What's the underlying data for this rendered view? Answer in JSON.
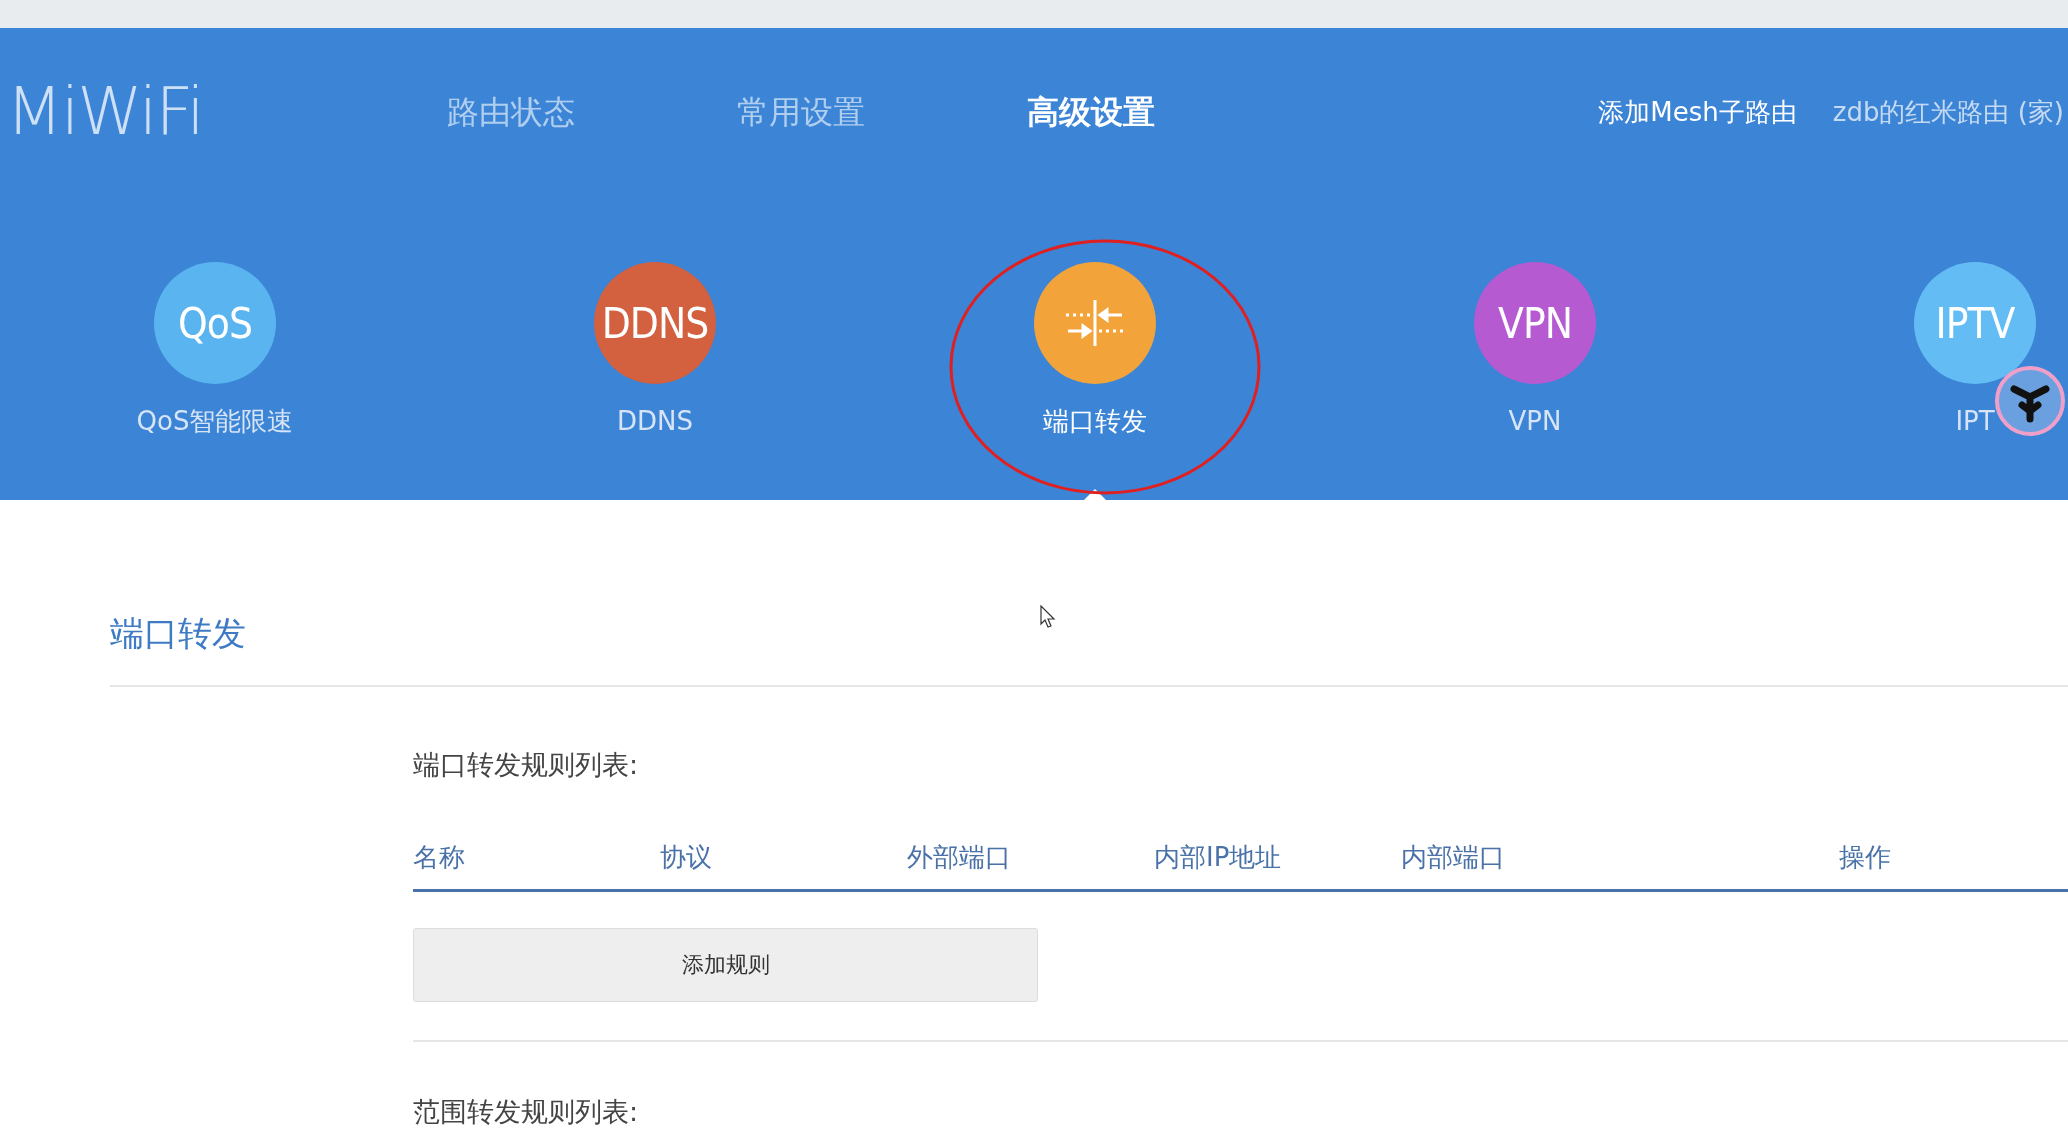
{
  "header": {
    "logo": "MiWiFi",
    "nav": [
      {
        "label": "路由状态",
        "selected": false
      },
      {
        "label": "常用设置",
        "selected": false
      },
      {
        "label": "高级设置",
        "selected": true
      }
    ],
    "links": [
      "添加Mesh子路由",
      "zdb的红米路由 (家)"
    ]
  },
  "features": [
    {
      "badge_text": "QoS",
      "label": "QoS智能限速",
      "color": "#5ab4ef",
      "selected": false
    },
    {
      "badge_text": "DDNS",
      "label": "DDNS",
      "color": "#d3603e",
      "selected": false
    },
    {
      "label": "端口转发",
      "color": "#f2a33a",
      "selected": true
    },
    {
      "badge_text": "VPN",
      "label": "VPN",
      "color": "#b65ad2",
      "selected": false
    },
    {
      "badge_text": "IPTV",
      "label": "IPT",
      "color": "#63bdf4",
      "selected": false
    }
  ],
  "section": {
    "title": "端口转发",
    "rules_title": "端口转发规则列表:",
    "columns": [
      "名称",
      "协议",
      "外部端口",
      "内部IP地址",
      "内部端口",
      "操作"
    ],
    "add_button": "添加规则",
    "range_title": "范围转发规则列表:"
  }
}
